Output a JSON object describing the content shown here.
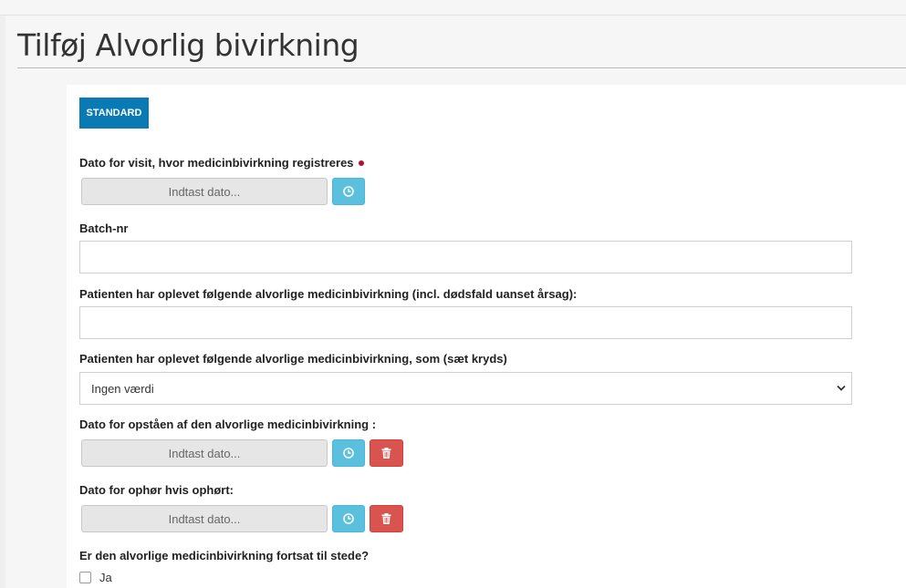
{
  "page": {
    "title": "Tilføj Alvorlig bivirkning"
  },
  "toolbar": {
    "standard_label": "STANDARD"
  },
  "fields": {
    "visit_date": {
      "label": "Dato for visit, hvor medicinbivirkning registreres",
      "placeholder": "Indtast dato...",
      "required": true
    },
    "batch": {
      "label": "Batch-nr",
      "value": ""
    },
    "reaction": {
      "label": "Patienten har oplevet følgende alvorlige medicinbivirkning (incl. dødsfald uanset årsag):",
      "value": ""
    },
    "reaction_type": {
      "label": "Patienten har oplevet følgende alvorlige medicinbivirkning, som (sæt kryds)",
      "selected": "Ingen værdi"
    },
    "onset_date": {
      "label": "Dato for opståen af den alvorlige medicinbivirkning :",
      "placeholder": "Indtast dato..."
    },
    "end_date": {
      "label": "Dato for ophør hvis ophørt:",
      "placeholder": "Indtast dato..."
    },
    "ongoing": {
      "label": "Er den alvorlige medicinbivirkning fortsat til stede?",
      "option_yes": "Ja",
      "checked": false
    }
  },
  "icons": {
    "clock": "clock-icon",
    "trash": "trash-icon",
    "chevron": "chevron-down-icon"
  },
  "colors": {
    "primary": "#0a7ab5",
    "info": "#5bc0de",
    "danger": "#d9534f",
    "required": "#b0122a"
  }
}
